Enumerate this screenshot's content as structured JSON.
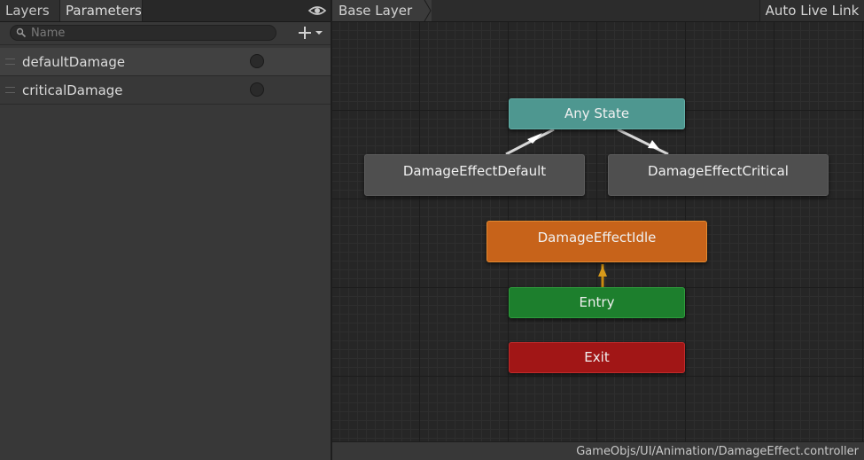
{
  "left_panel": {
    "tabs": {
      "layers": "Layers",
      "parameters": "Parameters"
    },
    "search": {
      "placeholder": "Name"
    },
    "parameters": [
      {
        "name": "defaultDamage"
      },
      {
        "name": "criticalDamage"
      }
    ]
  },
  "graph": {
    "breadcrumb": "Base Layer",
    "auto_live_link": "Auto Live Link",
    "states": {
      "any_state": "Any State",
      "default": "DamageEffectDefault",
      "critical": "DamageEffectCritical",
      "idle": "DamageEffectIdle",
      "entry": "Entry",
      "exit": "Exit"
    },
    "path": "GameObjs/UI/Animation/DamageEffect.controller"
  },
  "icons": [
    "eye-icon",
    "search-icon",
    "add-icon",
    "dropdown-arrow-icon",
    "breadcrumb-arrow-icon"
  ],
  "colors": {
    "any_state": "#4e9790",
    "state_default": "#4f4f4f",
    "default_state": "#c7631a",
    "entry": "#1d7f2d",
    "exit": "#a11616"
  }
}
